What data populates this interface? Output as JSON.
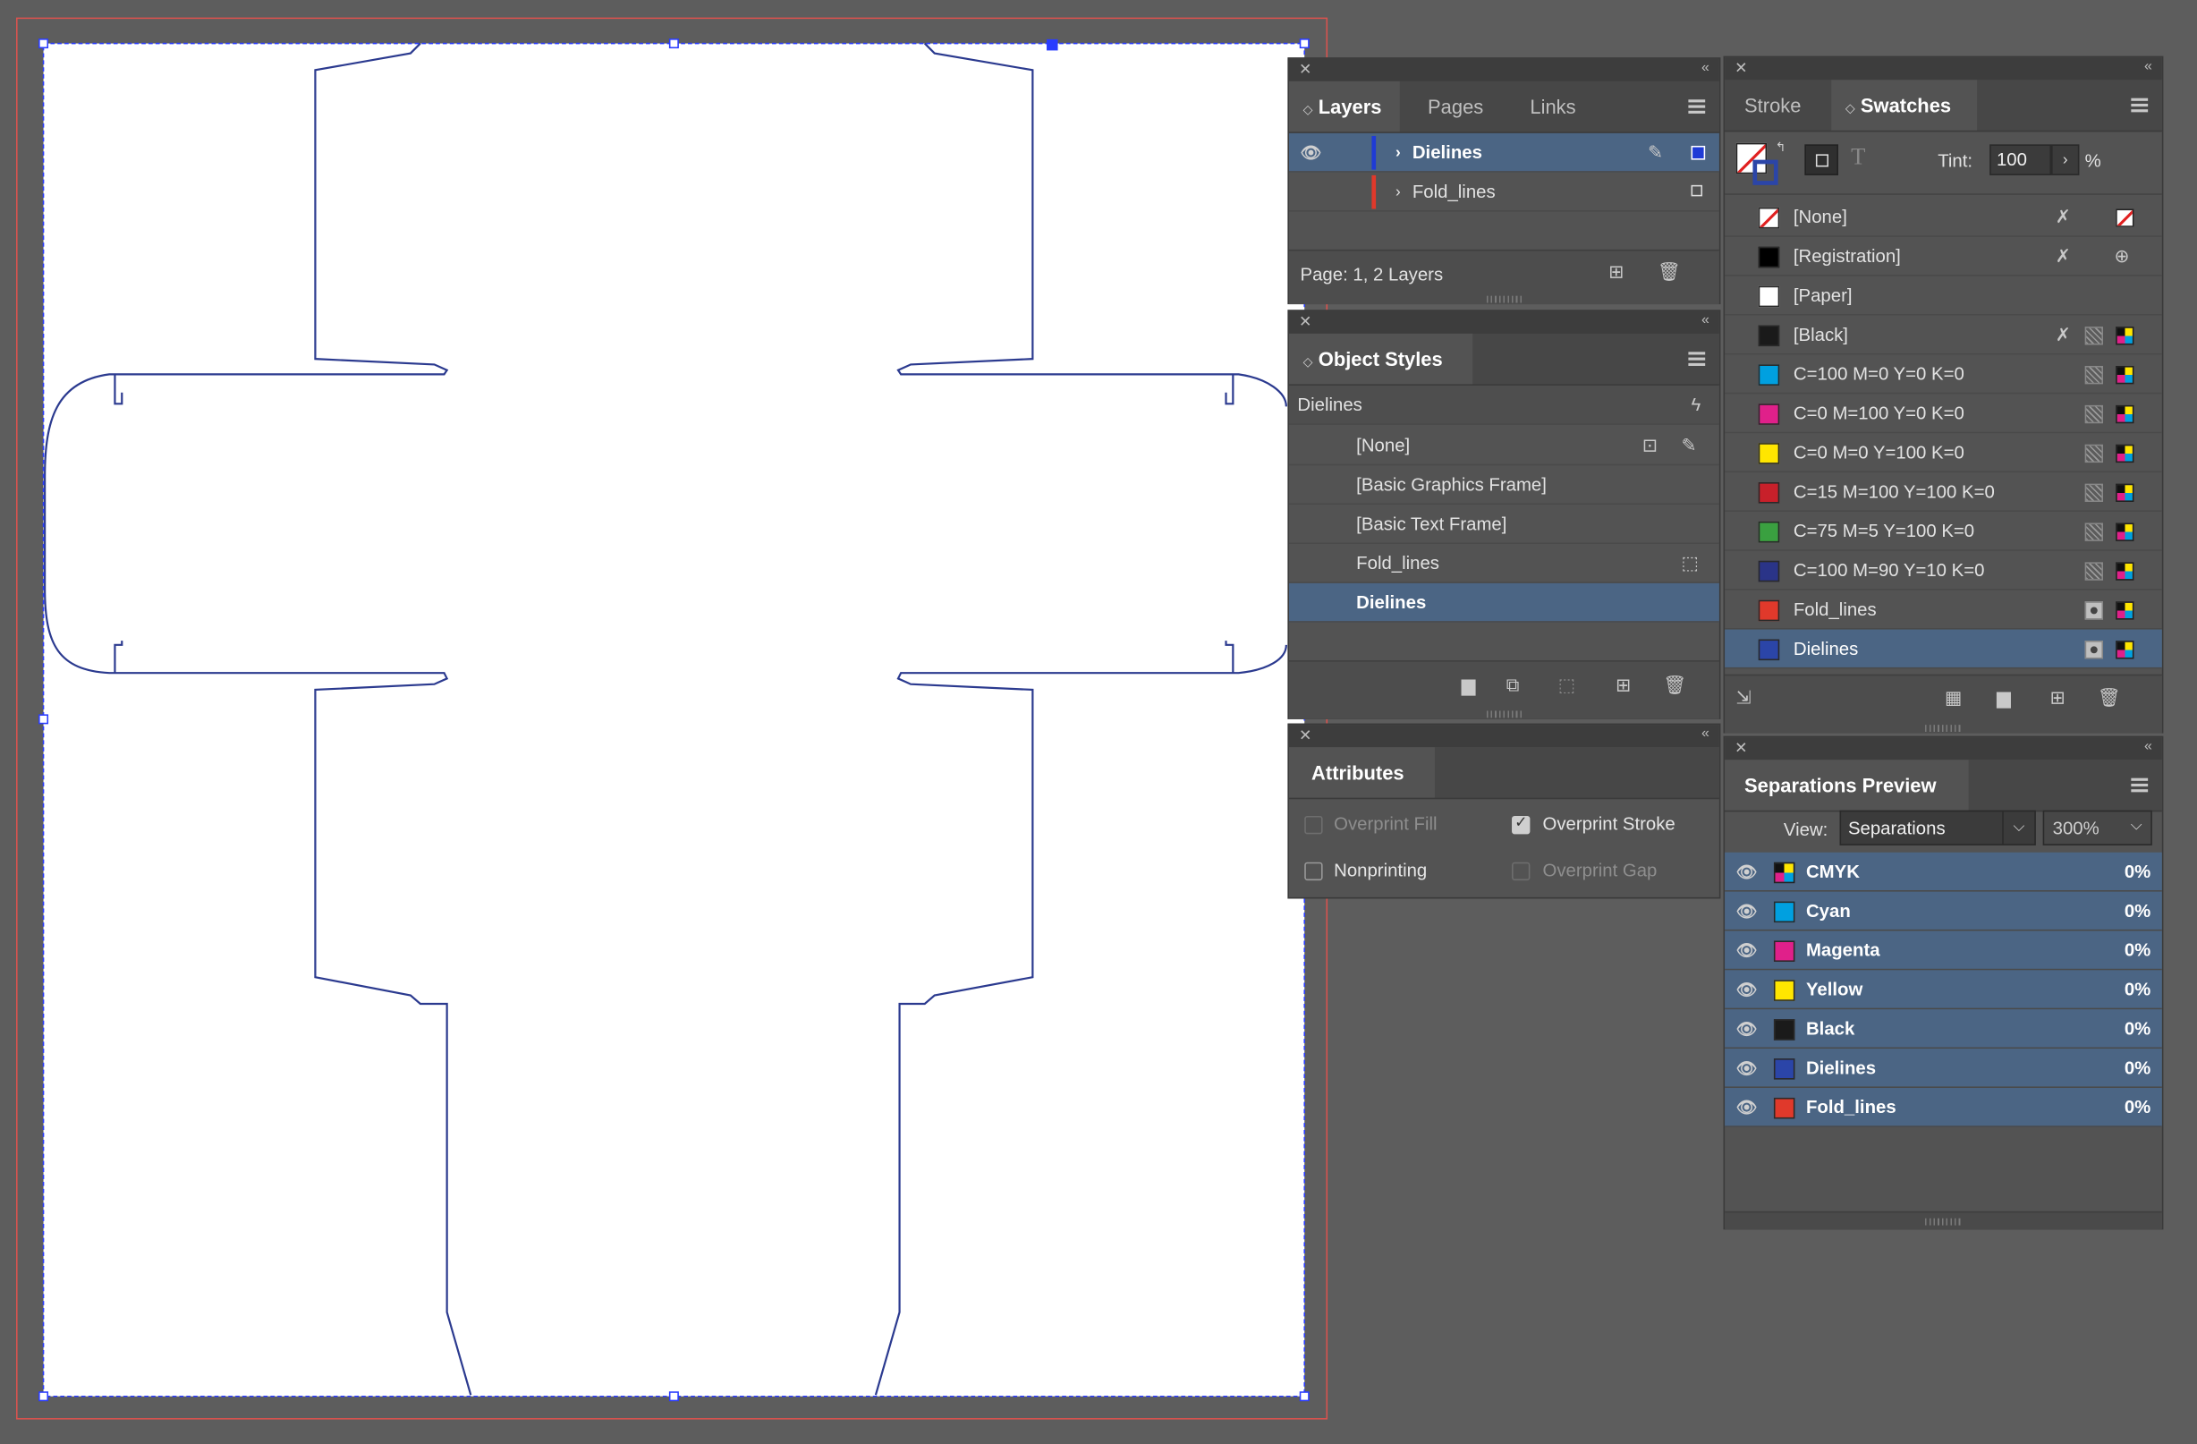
{
  "layers_panel": {
    "tabs": [
      "Layers",
      "Pages",
      "Links"
    ],
    "layers": [
      {
        "name": "Dielines",
        "color": "#1f3bd6",
        "selected": true
      },
      {
        "name": "Fold_lines",
        "color": "#e0392b",
        "selected": false
      }
    ],
    "status": "Page: 1, 2 Layers"
  },
  "object_styles_panel": {
    "title": "Object Styles",
    "current": "Dielines",
    "items": [
      "[None]",
      "[Basic Graphics Frame]",
      "[Basic Text Frame]",
      "Fold_lines",
      "Dielines"
    ],
    "selected_index": 4
  },
  "attributes_panel": {
    "title": "Attributes",
    "overprint_fill": "Overprint Fill",
    "overprint_stroke": "Overprint Stroke",
    "nonprinting": "Nonprinting",
    "overprint_gap": "Overprint Gap",
    "overprint_fill_checked": false,
    "overprint_stroke_checked": true,
    "nonprinting_checked": false
  },
  "swatches_panel": {
    "tabs": [
      "Stroke",
      "Swatches"
    ],
    "tint_label": "Tint:",
    "tint_value": "100",
    "tint_unit": "%",
    "swatches": [
      {
        "name": "[None]",
        "color": "none"
      },
      {
        "name": "[Registration]",
        "color": "#000000"
      },
      {
        "name": "[Paper]",
        "color": "#ffffff"
      },
      {
        "name": "[Black]",
        "color": "#1a1a1a"
      },
      {
        "name": "C=100 M=0 Y=0 K=0",
        "color": "#00a0e0"
      },
      {
        "name": "C=0 M=100 Y=0 K=0",
        "color": "#e0208a"
      },
      {
        "name": "C=0 M=0 Y=100 K=0",
        "color": "#ffe600"
      },
      {
        "name": "C=15 M=100 Y=100 K=0",
        "color": "#c8202a"
      },
      {
        "name": "C=75 M=5 Y=100 K=0",
        "color": "#3aa040"
      },
      {
        "name": "C=100 M=90 Y=10 K=0",
        "color": "#2a3488"
      },
      {
        "name": "Fold_lines",
        "color": "#e0392b"
      },
      {
        "name": "Dielines",
        "color": "#2b45a8"
      }
    ],
    "selected_index": 11
  },
  "separations_panel": {
    "title": "Separations Preview",
    "view_label": "View:",
    "view_value": "Separations",
    "zoom_value": "300%",
    "inks": [
      {
        "name": "CMYK",
        "color": "cmyk",
        "value": "0%"
      },
      {
        "name": "Cyan",
        "color": "#00a0e0",
        "value": "0%"
      },
      {
        "name": "Magenta",
        "color": "#e0208a",
        "value": "0%"
      },
      {
        "name": "Yellow",
        "color": "#ffe600",
        "value": "0%"
      },
      {
        "name": "Black",
        "color": "#1a1a1a",
        "value": "0%"
      },
      {
        "name": "Dielines",
        "color": "#2b45a8",
        "value": "0%"
      },
      {
        "name": "Fold_lines",
        "color": "#e0392b",
        "value": "0%"
      }
    ]
  },
  "colors": {
    "dieline": "#2b3a8f",
    "bleed": "#d9534f",
    "selection": "#2a3cff"
  }
}
